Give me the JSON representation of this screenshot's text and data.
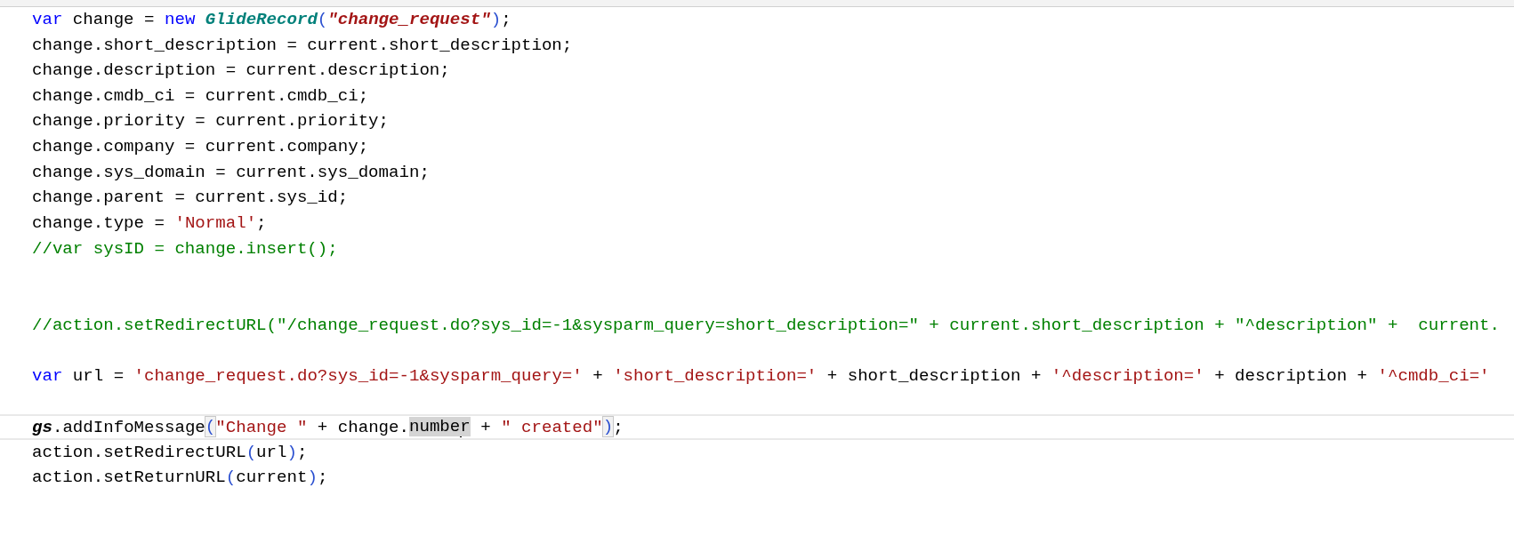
{
  "editor": {
    "lines": [
      {
        "current": false,
        "tokens": [
          {
            "kind": "keyword",
            "text": "var"
          },
          {
            "kind": "plain",
            "text": " change = "
          },
          {
            "kind": "keyword",
            "text": "new"
          },
          {
            "kind": "class",
            "text": " GlideRecord"
          },
          {
            "kind": "paren",
            "text": "("
          },
          {
            "kind": "string-em",
            "text": "\"change_request\""
          },
          {
            "kind": "paren",
            "text": ")"
          },
          {
            "kind": "plain",
            "text": ";"
          }
        ]
      },
      {
        "current": false,
        "tokens": [
          {
            "kind": "plain",
            "text": "change.short_description = current.short_description;"
          }
        ]
      },
      {
        "current": false,
        "tokens": [
          {
            "kind": "plain",
            "text": "change.description = current.description;"
          }
        ]
      },
      {
        "current": false,
        "tokens": [
          {
            "kind": "plain",
            "text": "change.cmdb_ci = current.cmdb_ci;"
          }
        ]
      },
      {
        "current": false,
        "tokens": [
          {
            "kind": "plain",
            "text": "change.priority = current.priority;"
          }
        ]
      },
      {
        "current": false,
        "tokens": [
          {
            "kind": "plain",
            "text": "change.company = current.company;"
          }
        ]
      },
      {
        "current": false,
        "tokens": [
          {
            "kind": "plain",
            "text": "change.sys_domain = current.sys_domain;"
          }
        ]
      },
      {
        "current": false,
        "tokens": [
          {
            "kind": "plain",
            "text": "change.parent = current.sys_id;"
          }
        ]
      },
      {
        "current": false,
        "tokens": [
          {
            "kind": "plain",
            "text": "change.type = "
          },
          {
            "kind": "string",
            "text": "'Normal'"
          },
          {
            "kind": "plain",
            "text": ";"
          }
        ]
      },
      {
        "current": false,
        "tokens": [
          {
            "kind": "comment",
            "text": "//var sysID = change.insert();"
          }
        ]
      },
      {
        "current": false
      },
      {
        "current": false
      },
      {
        "current": false,
        "tokens": [
          {
            "kind": "comment",
            "text": "//action.setRedirectURL(\"/change_request.do?sys_id=-1&sysparm_query=short_description=\" + current.short_description + \"^description\" +  current."
          }
        ]
      },
      {
        "current": false
      },
      {
        "current": false,
        "tokens": [
          {
            "kind": "keyword",
            "text": "var"
          },
          {
            "kind": "plain",
            "text": " url = "
          },
          {
            "kind": "string",
            "text": "'change_request.do?sys_id=-1&sysparm_query='"
          },
          {
            "kind": "plain",
            "text": " + "
          },
          {
            "kind": "string",
            "text": "'short_description='"
          },
          {
            "kind": "plain",
            "text": " + short_description + "
          },
          {
            "kind": "string",
            "text": "'^description='"
          },
          {
            "kind": "plain",
            "text": " + description + "
          },
          {
            "kind": "string",
            "text": "'^cmdb_ci='"
          }
        ]
      },
      {
        "current": false
      },
      {
        "current": true,
        "tokens": [
          {
            "kind": "global",
            "text": "gs"
          },
          {
            "kind": "plain",
            "text": ".addInfoMessage"
          },
          {
            "kind": "paren",
            "text": "(",
            "matched": true
          },
          {
            "kind": "string",
            "text": "\"Change \""
          },
          {
            "kind": "plain",
            "text": " + change."
          },
          {
            "kind": "plain",
            "text": "numbe",
            "highlighted": true
          },
          {
            "kind": "cursor"
          },
          {
            "kind": "plain",
            "text": "r",
            "highlighted": true
          },
          {
            "kind": "plain",
            "text": " + "
          },
          {
            "kind": "string",
            "text": "\" created\""
          },
          {
            "kind": "paren",
            "text": ")",
            "matched": true
          },
          {
            "kind": "plain",
            "text": ";"
          }
        ]
      },
      {
        "current": false,
        "tokens": [
          {
            "kind": "plain",
            "text": "action.setRedirectURL"
          },
          {
            "kind": "paren",
            "text": "("
          },
          {
            "kind": "plain",
            "text": "url"
          },
          {
            "kind": "paren",
            "text": ")"
          },
          {
            "kind": "plain",
            "text": ";"
          }
        ]
      },
      {
        "current": false,
        "tokens": [
          {
            "kind": "plain",
            "text": "action.setReturnURL"
          },
          {
            "kind": "paren",
            "text": "("
          },
          {
            "kind": "plain",
            "text": "current"
          },
          {
            "kind": "paren",
            "text": ")"
          },
          {
            "kind": "plain",
            "text": ";"
          }
        ]
      }
    ]
  }
}
